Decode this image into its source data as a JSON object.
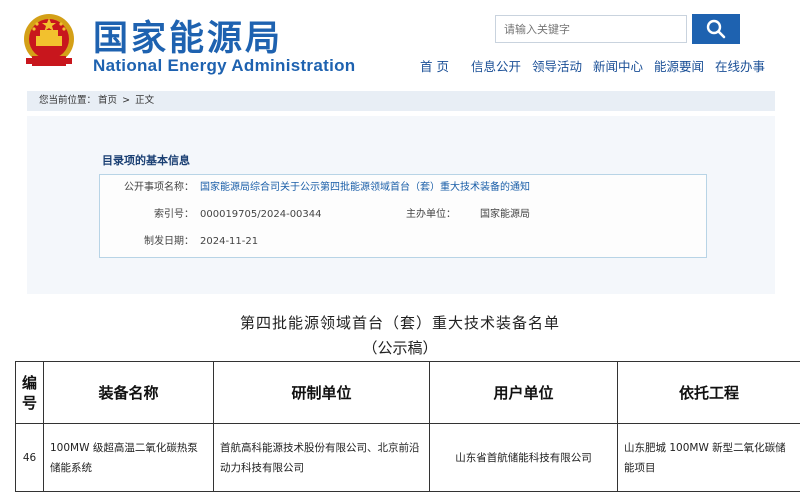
{
  "header": {
    "title_cn": "国家能源局",
    "title_en": "National Energy Administration",
    "emblem_icon": "national-emblem-icon",
    "brand_color": "#1e62b0"
  },
  "search": {
    "placeholder": "请输入关键字",
    "button_icon": "search-icon"
  },
  "nav": {
    "items": [
      "首 页",
      "信息公开",
      "领导活动",
      "新闻中心",
      "能源要闻",
      "在线办事"
    ]
  },
  "breadcrumb": {
    "label": "您当前位置：",
    "home": "首页",
    "separator": ">",
    "current": "正文"
  },
  "catalog": {
    "section_title": "目录项的基本信息",
    "fields": {
      "title_label": "公开事项名称：",
      "title_value": "国家能源局综合司关于公示第四批能源领域首台（套）重大技术装备的通知",
      "index_label": "索引号：",
      "index_value": "000019705/2024-00344",
      "org_label": "主办单位：",
      "org_value": "国家能源局",
      "date_label": "制发日期：",
      "date_value": "2024-11-21"
    }
  },
  "document": {
    "title": "第四批能源领域首台（套）重大技术装备名单",
    "subtitle": "（公示稿）",
    "table": {
      "headers": {
        "no_1": "编",
        "no_2": "号",
        "name": "装备名称",
        "rd_unit": "研制单位",
        "user_unit": "用户单位",
        "project": "依托工程"
      },
      "rows": [
        {
          "no": "46",
          "name": "100MW 级超高温二氧化碳热泵储能系统",
          "rd_unit": "首航高科能源技术股份有限公司、北京前沿动力科技有限公司",
          "user_unit": "山东省首航储能科技有限公司",
          "project": "山东肥城 100MW 新型二氧化碳储能项目"
        }
      ]
    }
  }
}
